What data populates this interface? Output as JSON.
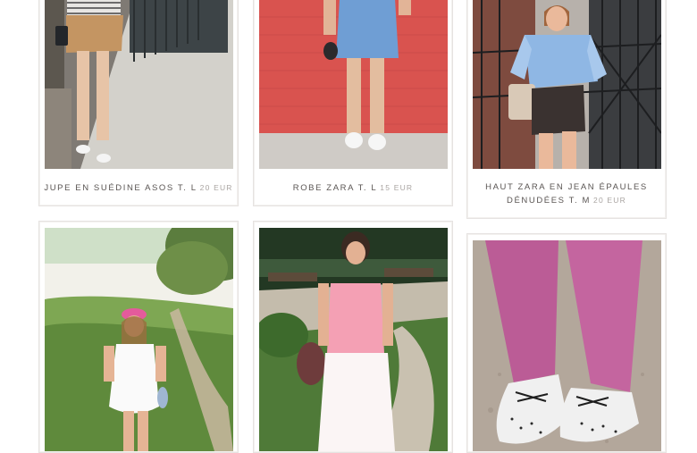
{
  "products": [
    {
      "title": "JUPE EN SUÉDINE ASOS T. L",
      "price": "20 EUR",
      "image_name": "photo-jupe-suedine"
    },
    {
      "title": "ROBE ZARA T. L",
      "price": "15 EUR",
      "image_name": "photo-robe-zara"
    },
    {
      "title_line1": "HAUT ZARA EN JEAN ÉPAULES",
      "title_line2": "DÉNUDÉES T. M",
      "price": "20 EUR",
      "image_name": "photo-haut-zara"
    },
    {
      "image_name": "photo-robe-blanche"
    },
    {
      "image_name": "photo-haut-rose"
    },
    {
      "image_name": "photo-pantalon-rose"
    }
  ]
}
